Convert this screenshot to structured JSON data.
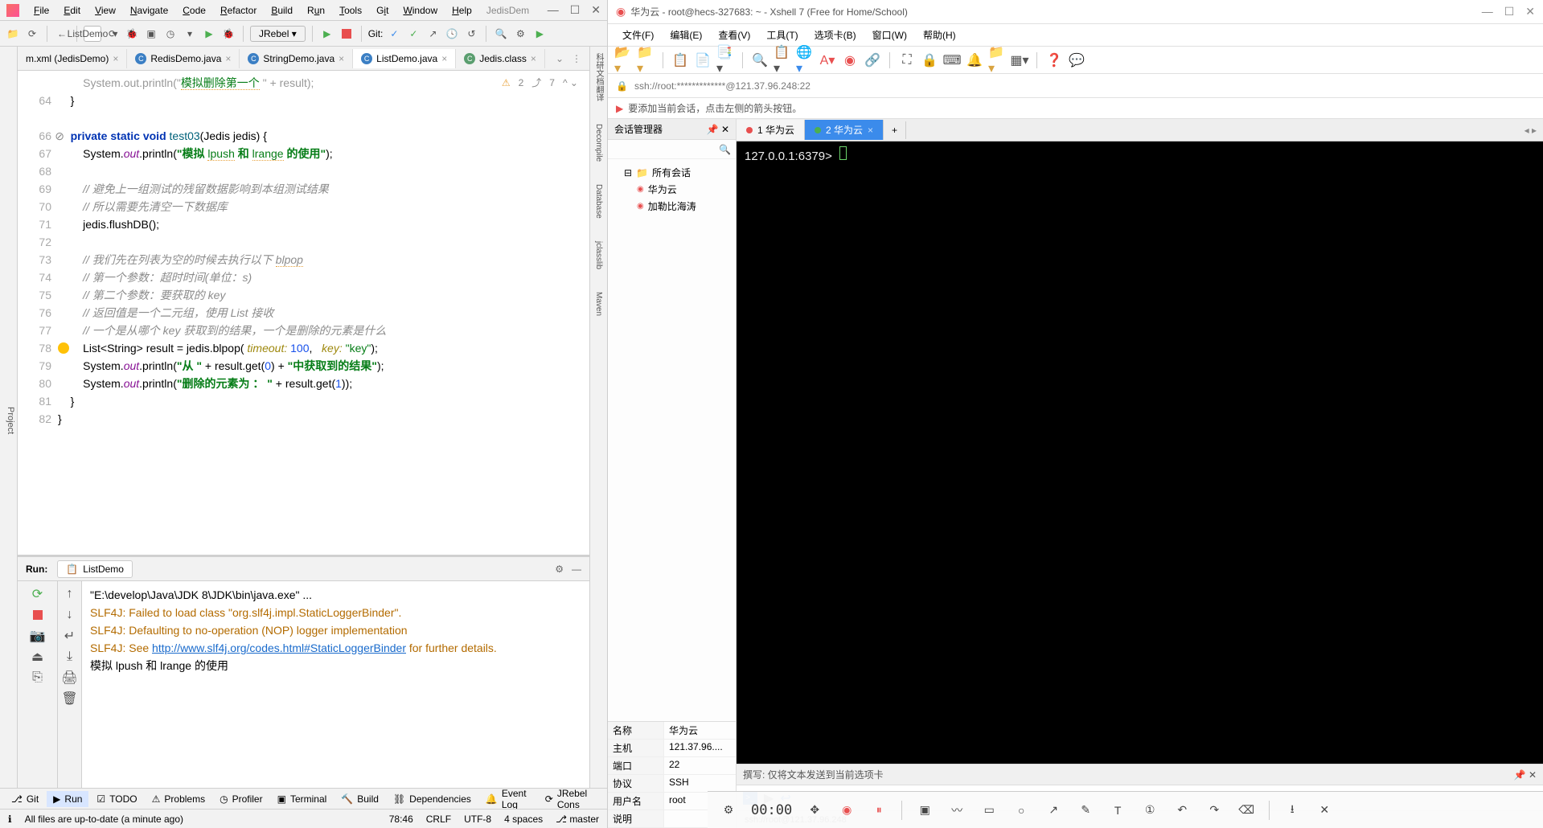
{
  "intellij": {
    "menu": [
      "File",
      "Edit",
      "View",
      "Navigate",
      "Code",
      "Refactor",
      "Build",
      "Run",
      "Tools",
      "Git",
      "Window",
      "Help"
    ],
    "app_title": "JedisDem",
    "toolbar": {
      "run_config": "ListDemo",
      "rebel": "JRebel",
      "git_label": "Git:"
    },
    "tabs": [
      {
        "label": "m.xml (JedisDemo)"
      },
      {
        "label": "RedisDemo.java"
      },
      {
        "label": "StringDemo.java"
      },
      {
        "label": "ListDemo.java",
        "active": true
      },
      {
        "label": "Jedis.class"
      }
    ],
    "inspection": {
      "warn": "2",
      "weak": "7"
    },
    "gutter_start": 64,
    "left_side": [
      "Project"
    ],
    "right_side": [
      "科研文档翻译",
      "Decompile",
      "Database",
      "jclasslib",
      "Maven"
    ],
    "code": {
      "sig_private": "private",
      "sig_static": "static",
      "sig_void": "void",
      "sig_name": "test03",
      "sig_param": "(Jedis jedis) {",
      "l67a": "System.",
      "l67b": "out",
      "l67c": ".println(",
      "l67d": "\"模拟 ",
      "l67e": "lpush",
      "l67f": " 和 ",
      "l67g": "lrange",
      "l67h": " 的使用\"",
      "l67i": ");",
      "l69": "// 避免上一组测试的残留数据影响到本组测试结果",
      "l70": "// 所以需要先清空一下数据库",
      "l71": "jedis.flushDB();",
      "l73": "// 我们先在列表为空的时候去执行以下 ",
      "l73b": "blpop",
      "l74": "// 第一个参数：超时时间(单位：s)",
      "l75": "// 第二个参数：要获取的 key",
      "l76": "// 返回值是一个二元组，使用 List 接收",
      "l77": "// 一个是从哪个 key 获取到的结果，一个是删除的元素是什么",
      "l78a": "List<",
      "l78b": "String",
      "l78c": "> result = jedis.blpop( ",
      "l78t": "timeout: ",
      "l78n": "100",
      "l78d": ",   ",
      "l78k": "key: ",
      "l78s": "\"key\"",
      "l78e": ");",
      "l79a": "System.",
      "l79b": "out",
      "l79c": ".println(",
      "l79d": "\"从 \"",
      "l79e": " + result.get(",
      "l79n": "0",
      "l79f": ") + ",
      "l79g": "\"中获取到的结果\"",
      "l79h": ");",
      "l80a": "System.",
      "l80b": "out",
      "l80c": ".println(",
      "l80d": "\"删除的元素为 ： \"",
      "l80e": " + result.get(",
      "l80n": "1",
      "l80f": "));",
      "l81": "}",
      "l82": "}",
      "l64": "}"
    },
    "run": {
      "label": "Run:",
      "tab": "ListDemo",
      "lines": [
        {
          "t": "\"E:\\develop\\Java\\JDK 8\\JDK\\bin\\java.exe\" ...",
          "cls": ""
        },
        {
          "t": "SLF4J: Failed to load class \"org.slf4j.impl.StaticLoggerBinder\".",
          "cls": "cons-warn"
        },
        {
          "t": "SLF4J: Defaulting to no-operation (NOP) logger implementation",
          "cls": "cons-warn"
        },
        {
          "pre": "SLF4J: See ",
          "link": "http://www.slf4j.org/codes.html#StaticLoggerBinder",
          "post": " for further details.",
          "cls": "cons-warn"
        },
        {
          "t": "模拟 lpush 和 lrange 的使用",
          "cls": ""
        }
      ]
    },
    "bottom": [
      "Git",
      "Run",
      "TODO",
      "Problems",
      "Profiler",
      "Terminal",
      "Build",
      "Dependencies",
      "Event Log",
      "JRebel Cons"
    ],
    "bottom_active": "Run",
    "status": {
      "msg": "All files are up-to-date (a minute ago)",
      "pos": "78:46",
      "le": "CRLF",
      "enc": "UTF-8",
      "indent": "4 spaces",
      "branch": "master"
    }
  },
  "xshell": {
    "title": "华为云 - root@hecs-327683: ~ - Xshell 7 (Free for Home/School)",
    "menu": [
      "文件(F)",
      "编辑(E)",
      "查看(V)",
      "工具(T)",
      "选项卡(B)",
      "窗口(W)",
      "帮助(H)"
    ],
    "addr": "ssh://root:*************@121.37.96.248:22",
    "tip": "要添加当前会话，点击左侧的箭头按钮。",
    "session_mgr": "会话管理器",
    "tree": {
      "root": "所有会话",
      "items": [
        "华为云",
        "加勒比海涛"
      ]
    },
    "props": [
      {
        "k": "名称",
        "v": "华为云"
      },
      {
        "k": "主机",
        "v": "121.37.96...."
      },
      {
        "k": "端口",
        "v": "22"
      },
      {
        "k": "协议",
        "v": "SSH"
      },
      {
        "k": "用户名",
        "v": "root"
      },
      {
        "k": "说明",
        "v": ""
      }
    ],
    "tabs": [
      {
        "label": "1 华为云",
        "dot": "r"
      },
      {
        "label": "2 华为云",
        "dot": "g",
        "active": true
      }
    ],
    "prompt": "127.0.0.1:6379>",
    "compose": "撰写: 仅将文本发送到当前选项卡",
    "status": "ssh://root@121.37.96.248"
  },
  "recorder": {
    "time": "00:00"
  }
}
